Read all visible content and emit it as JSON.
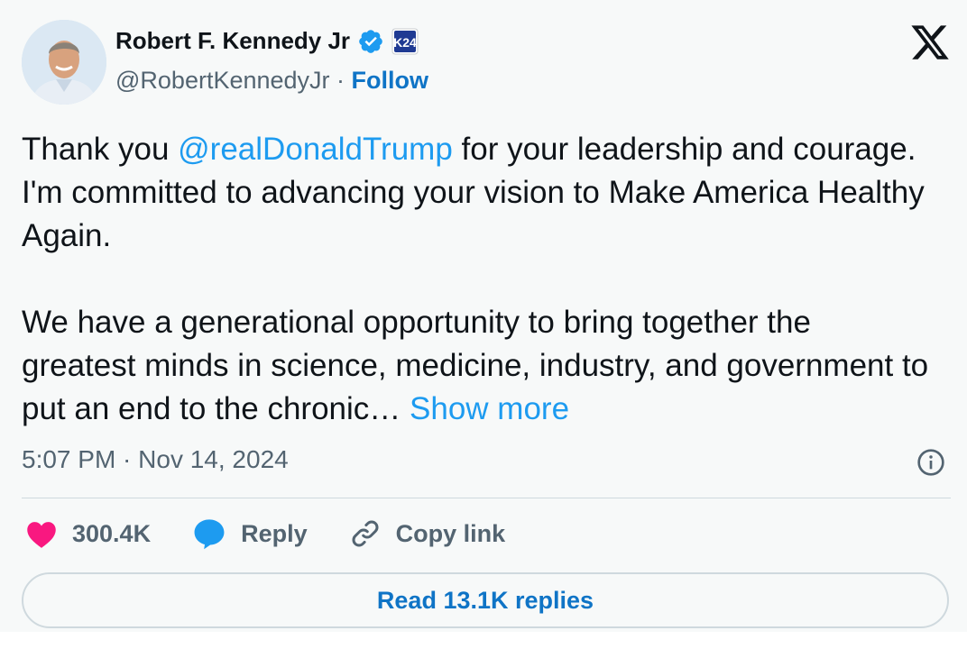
{
  "author": {
    "name": "Robert F. Kennedy Jr",
    "handle": "@RobertKennedyJr",
    "separator": " · ",
    "follow_label": "Follow",
    "badge_text": "K24"
  },
  "tweet": {
    "p1_before": "Thank you ",
    "p1_mention": "@realDonaldTrump",
    "p1_after": " for your leadership and courage. I'm committed to advancing your vision to Make America Healthy Again.",
    "p2_text": "We have a generational opportunity to bring together the greatest minds in science, medicine, industry, and government to put an end to the chronic…",
    "show_more": "Show more",
    "timestamp": "5:07 PM · Nov 14, 2024"
  },
  "actions": {
    "likes": "300.4K",
    "reply_label": "Reply",
    "copy_link_label": "Copy link"
  },
  "footer": {
    "read_replies_label": "Read 13.1K replies"
  },
  "colors": {
    "accent_blue": "#1d9bf0",
    "follow_blue": "#0f74c6",
    "heart_pink": "#f91880",
    "text_primary": "#0f1419",
    "text_secondary": "#536471"
  }
}
